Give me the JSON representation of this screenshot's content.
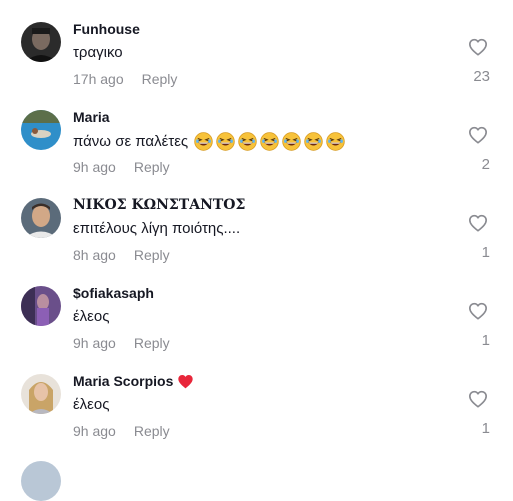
{
  "comments": [
    {
      "username": "Funhouse",
      "text": "τραγικο",
      "time": "17h ago",
      "reply": "Reply",
      "likes": "23",
      "avatar": "dark-portrait"
    },
    {
      "username": "Maria",
      "text": "πάνω σε παλέτες",
      "time": "9h ago",
      "reply": "Reply",
      "likes": "2",
      "avatar": "pool-photo",
      "emoji_count": 7
    },
    {
      "username": "ΝΙΚΟΣ ΚΩΝΣΤΑΝΤΟΣ",
      "text": "επιτέλους λίγη ποιότης....",
      "time": "8h ago",
      "reply": "Reply",
      "likes": "1",
      "avatar": "man-portrait"
    },
    {
      "username": "$ofiakasaph",
      "text": "έλεος",
      "time": "9h ago",
      "reply": "Reply",
      "likes": "1",
      "avatar": "purple-photo"
    },
    {
      "username": "Maria Scorpios",
      "text": "έλεος",
      "time": "9h ago",
      "reply": "Reply",
      "likes": "1",
      "avatar": "woman-portrait",
      "badge": "red-heart"
    }
  ],
  "colors": {
    "muted": "#8a8b91",
    "text": "#161823",
    "heart_badge": "#e8263a"
  },
  "icons": {
    "like": "heart-outline-icon",
    "emoji": "grinning-squinting-face-emoji"
  }
}
